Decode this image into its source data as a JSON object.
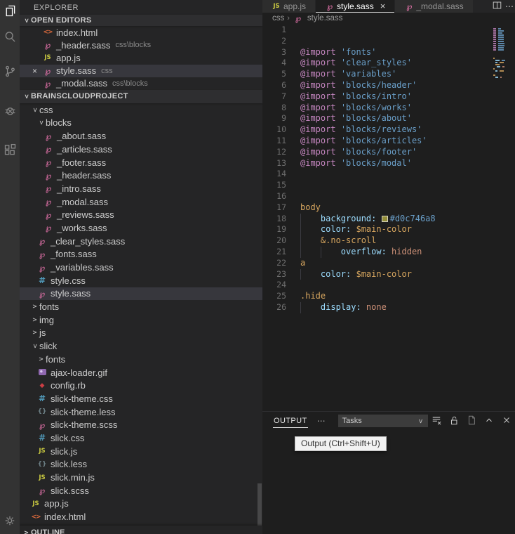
{
  "window": {
    "sidebar_title": "EXPLORER"
  },
  "activity_bar": {
    "items": [
      {
        "name": "explorer",
        "active": true
      },
      {
        "name": "search",
        "active": false
      },
      {
        "name": "source-control",
        "active": false
      },
      {
        "name": "debug",
        "active": false
      },
      {
        "name": "extensions",
        "active": false
      }
    ],
    "bottom_items": [
      {
        "name": "settings",
        "active": false
      }
    ]
  },
  "open_editors": {
    "header": "OPEN EDITORS",
    "items": [
      {
        "label": "index.html",
        "icon": "html",
        "desc": "",
        "active": false,
        "close": false
      },
      {
        "label": "_header.sass",
        "icon": "sass",
        "desc": "css\\blocks",
        "active": false,
        "close": false
      },
      {
        "label": "app.js",
        "icon": "js",
        "desc": "",
        "active": false,
        "close": false
      },
      {
        "label": "style.sass",
        "icon": "sass",
        "desc": "css",
        "active": true,
        "close": true
      },
      {
        "label": "_modal.sass",
        "icon": "sass",
        "desc": "css\\blocks",
        "active": false,
        "close": false
      }
    ]
  },
  "project": {
    "header": "BRAINSCLOUDPROJECT",
    "tree": [
      {
        "label": "css",
        "kind": "folder",
        "indent": 1,
        "expanded": true
      },
      {
        "label": "blocks",
        "kind": "folder",
        "indent": 2,
        "expanded": true
      },
      {
        "label": "_about.sass",
        "kind": "file",
        "icon": "sass",
        "indent": 3
      },
      {
        "label": "_articles.sass",
        "kind": "file",
        "icon": "sass",
        "indent": 3
      },
      {
        "label": "_footer.sass",
        "kind": "file",
        "icon": "sass",
        "indent": 3
      },
      {
        "label": "_header.sass",
        "kind": "file",
        "icon": "sass",
        "indent": 3
      },
      {
        "label": "_intro.sass",
        "kind": "file",
        "icon": "sass",
        "indent": 3
      },
      {
        "label": "_modal.sass",
        "kind": "file",
        "icon": "sass",
        "indent": 3
      },
      {
        "label": "_reviews.sass",
        "kind": "file",
        "icon": "sass",
        "indent": 3
      },
      {
        "label": "_works.sass",
        "kind": "file",
        "icon": "sass",
        "indent": 3
      },
      {
        "label": "_clear_styles.sass",
        "kind": "file",
        "icon": "sass",
        "indent": 2
      },
      {
        "label": "_fonts.sass",
        "kind": "file",
        "icon": "sass",
        "indent": 2
      },
      {
        "label": "_variables.sass",
        "kind": "file",
        "icon": "sass",
        "indent": 2
      },
      {
        "label": "style.css",
        "kind": "file",
        "icon": "css",
        "indent": 2
      },
      {
        "label": "style.sass",
        "kind": "file",
        "icon": "sass",
        "indent": 2,
        "selected": true
      },
      {
        "label": "fonts",
        "kind": "folder",
        "indent": 1,
        "expanded": false
      },
      {
        "label": "img",
        "kind": "folder",
        "indent": 1,
        "expanded": false
      },
      {
        "label": "js",
        "kind": "folder",
        "indent": 1,
        "expanded": false
      },
      {
        "label": "slick",
        "kind": "folder",
        "indent": 1,
        "expanded": true
      },
      {
        "label": "fonts",
        "kind": "folder",
        "indent": 2,
        "expanded": false
      },
      {
        "label": "ajax-loader.gif",
        "kind": "file",
        "icon": "image",
        "indent": 2
      },
      {
        "label": "config.rb",
        "kind": "file",
        "icon": "ruby",
        "indent": 2
      },
      {
        "label": "slick-theme.css",
        "kind": "file",
        "icon": "css",
        "indent": 2
      },
      {
        "label": "slick-theme.less",
        "kind": "file",
        "icon": "less",
        "indent": 2
      },
      {
        "label": "slick-theme.scss",
        "kind": "file",
        "icon": "sass",
        "indent": 2
      },
      {
        "label": "slick.css",
        "kind": "file",
        "icon": "css",
        "indent": 2
      },
      {
        "label": "slick.js",
        "kind": "file",
        "icon": "js",
        "indent": 2
      },
      {
        "label": "slick.less",
        "kind": "file",
        "icon": "less",
        "indent": 2
      },
      {
        "label": "slick.min.js",
        "kind": "file",
        "icon": "js",
        "indent": 2
      },
      {
        "label": "slick.scss",
        "kind": "file",
        "icon": "sass",
        "indent": 2
      },
      {
        "label": "app.js",
        "kind": "file",
        "icon": "js",
        "indent": 1
      },
      {
        "label": "index.html",
        "kind": "file",
        "icon": "html",
        "indent": 1
      }
    ]
  },
  "outline": {
    "header": "OUTLINE"
  },
  "tabs": {
    "items": [
      {
        "label": "app.js",
        "icon": "js",
        "active": false,
        "close": false
      },
      {
        "label": "style.sass",
        "icon": "sass",
        "active": true,
        "close": true
      },
      {
        "label": "_modal.sass",
        "icon": "sass",
        "active": false,
        "close": false
      }
    ],
    "actions": [
      {
        "name": "split-editor"
      },
      {
        "name": "more-actions"
      }
    ]
  },
  "breadcrumbs": {
    "separator": "›",
    "items": [
      {
        "label": "css"
      },
      {
        "label": "style.sass",
        "icon": "sass"
      }
    ]
  },
  "editor": {
    "lines": [
      {
        "n": 1,
        "indent": 0,
        "tokens": []
      },
      {
        "n": 2,
        "indent": 0,
        "tokens": []
      },
      {
        "n": 3,
        "indent": 0,
        "tokens": [
          {
            "c": "kw",
            "t": "@import"
          },
          {
            "c": "plain",
            "t": " "
          },
          {
            "c": "str",
            "t": "'fonts'"
          }
        ]
      },
      {
        "n": 4,
        "indent": 0,
        "tokens": [
          {
            "c": "kw",
            "t": "@import"
          },
          {
            "c": "plain",
            "t": " "
          },
          {
            "c": "str",
            "t": "'clear_styles'"
          }
        ]
      },
      {
        "n": 5,
        "indent": 0,
        "tokens": [
          {
            "c": "kw",
            "t": "@import"
          },
          {
            "c": "plain",
            "t": " "
          },
          {
            "c": "str",
            "t": "'variables'"
          }
        ]
      },
      {
        "n": 6,
        "indent": 0,
        "tokens": [
          {
            "c": "kw",
            "t": "@import"
          },
          {
            "c": "plain",
            "t": " "
          },
          {
            "c": "str",
            "t": "'blocks/header'"
          }
        ]
      },
      {
        "n": 7,
        "indent": 0,
        "tokens": [
          {
            "c": "kw",
            "t": "@import"
          },
          {
            "c": "plain",
            "t": " "
          },
          {
            "c": "str",
            "t": "'blocks/intro'"
          }
        ]
      },
      {
        "n": 8,
        "indent": 0,
        "tokens": [
          {
            "c": "kw",
            "t": "@import"
          },
          {
            "c": "plain",
            "t": " "
          },
          {
            "c": "str",
            "t": "'blocks/works'"
          }
        ]
      },
      {
        "n": 9,
        "indent": 0,
        "tokens": [
          {
            "c": "kw",
            "t": "@import"
          },
          {
            "c": "plain",
            "t": " "
          },
          {
            "c": "str",
            "t": "'blocks/about'"
          }
        ]
      },
      {
        "n": 10,
        "indent": 0,
        "tokens": [
          {
            "c": "kw",
            "t": "@import"
          },
          {
            "c": "plain",
            "t": " "
          },
          {
            "c": "str",
            "t": "'blocks/reviews'"
          }
        ]
      },
      {
        "n": 11,
        "indent": 0,
        "tokens": [
          {
            "c": "kw",
            "t": "@import"
          },
          {
            "c": "plain",
            "t": " "
          },
          {
            "c": "str",
            "t": "'blocks/articles'"
          }
        ]
      },
      {
        "n": 12,
        "indent": 0,
        "tokens": [
          {
            "c": "kw",
            "t": "@import"
          },
          {
            "c": "plain",
            "t": " "
          },
          {
            "c": "str",
            "t": "'blocks/footer'"
          }
        ]
      },
      {
        "n": 13,
        "indent": 0,
        "tokens": [
          {
            "c": "kw",
            "t": "@import"
          },
          {
            "c": "plain",
            "t": " "
          },
          {
            "c": "str",
            "t": "'blocks/modal'"
          }
        ]
      },
      {
        "n": 14,
        "indent": 0,
        "tokens": []
      },
      {
        "n": 15,
        "indent": 0,
        "tokens": []
      },
      {
        "n": 16,
        "indent": 0,
        "tokens": []
      },
      {
        "n": 17,
        "indent": 0,
        "tokens": [
          {
            "c": "sel",
            "t": "body"
          }
        ]
      },
      {
        "n": 18,
        "indent": 1,
        "tokens": [
          {
            "c": "prop",
            "t": "background:"
          },
          {
            "c": "plain",
            "t": " "
          },
          {
            "c": "swatch",
            "t": ""
          },
          {
            "c": "str",
            "t": "#d0c746a8"
          }
        ]
      },
      {
        "n": 19,
        "indent": 1,
        "tokens": [
          {
            "c": "prop",
            "t": "color:"
          },
          {
            "c": "plain",
            "t": " "
          },
          {
            "c": "var",
            "t": "$main-color"
          }
        ]
      },
      {
        "n": 20,
        "indent": 1,
        "tokens": [
          {
            "c": "sel",
            "t": "&.no-scroll"
          }
        ]
      },
      {
        "n": 21,
        "indent": 2,
        "tokens": [
          {
            "c": "prop",
            "t": "overflow:"
          },
          {
            "c": "plain",
            "t": " "
          },
          {
            "c": "val",
            "t": "hidden"
          }
        ]
      },
      {
        "n": 22,
        "indent": 0,
        "tokens": [
          {
            "c": "sel",
            "t": "a"
          }
        ]
      },
      {
        "n": 23,
        "indent": 1,
        "tokens": [
          {
            "c": "prop",
            "t": "color:"
          },
          {
            "c": "plain",
            "t": " "
          },
          {
            "c": "var",
            "t": "$main-color"
          }
        ]
      },
      {
        "n": 24,
        "indent": 0,
        "tokens": []
      },
      {
        "n": 25,
        "indent": 0,
        "tokens": [
          {
            "c": "sel",
            "t": ".hide"
          }
        ]
      },
      {
        "n": 26,
        "indent": 1,
        "tokens": [
          {
            "c": "prop",
            "t": "display:"
          },
          {
            "c": "plain",
            "t": " "
          },
          {
            "c": "val",
            "t": "none"
          }
        ]
      }
    ]
  },
  "panel": {
    "tab": "OUTPUT",
    "more_label": "⋯",
    "dropdown_value": "Tasks",
    "tooltip": "Output (Ctrl+Shift+U)",
    "actions": [
      {
        "name": "clear-output",
        "dim": false
      },
      {
        "name": "unlock",
        "dim": false
      },
      {
        "name": "open-log-file",
        "dim": true
      },
      {
        "name": "maximize-panel",
        "dim": false
      },
      {
        "name": "close-panel",
        "dim": false
      }
    ]
  },
  "colors": {
    "keyword": "#c586c0",
    "string": "#6a9fc9",
    "selector": "#d7a65f",
    "property": "#9cdcfe",
    "value": "#ce9178",
    "variable": "#d7a65f",
    "plain": "#cccccc",
    "swatch": "#d0c746",
    "editor_bg": "#1e1e1e",
    "sidebar_bg": "#252526",
    "activity_bg": "#333333",
    "selection_bg": "#37373d"
  }
}
